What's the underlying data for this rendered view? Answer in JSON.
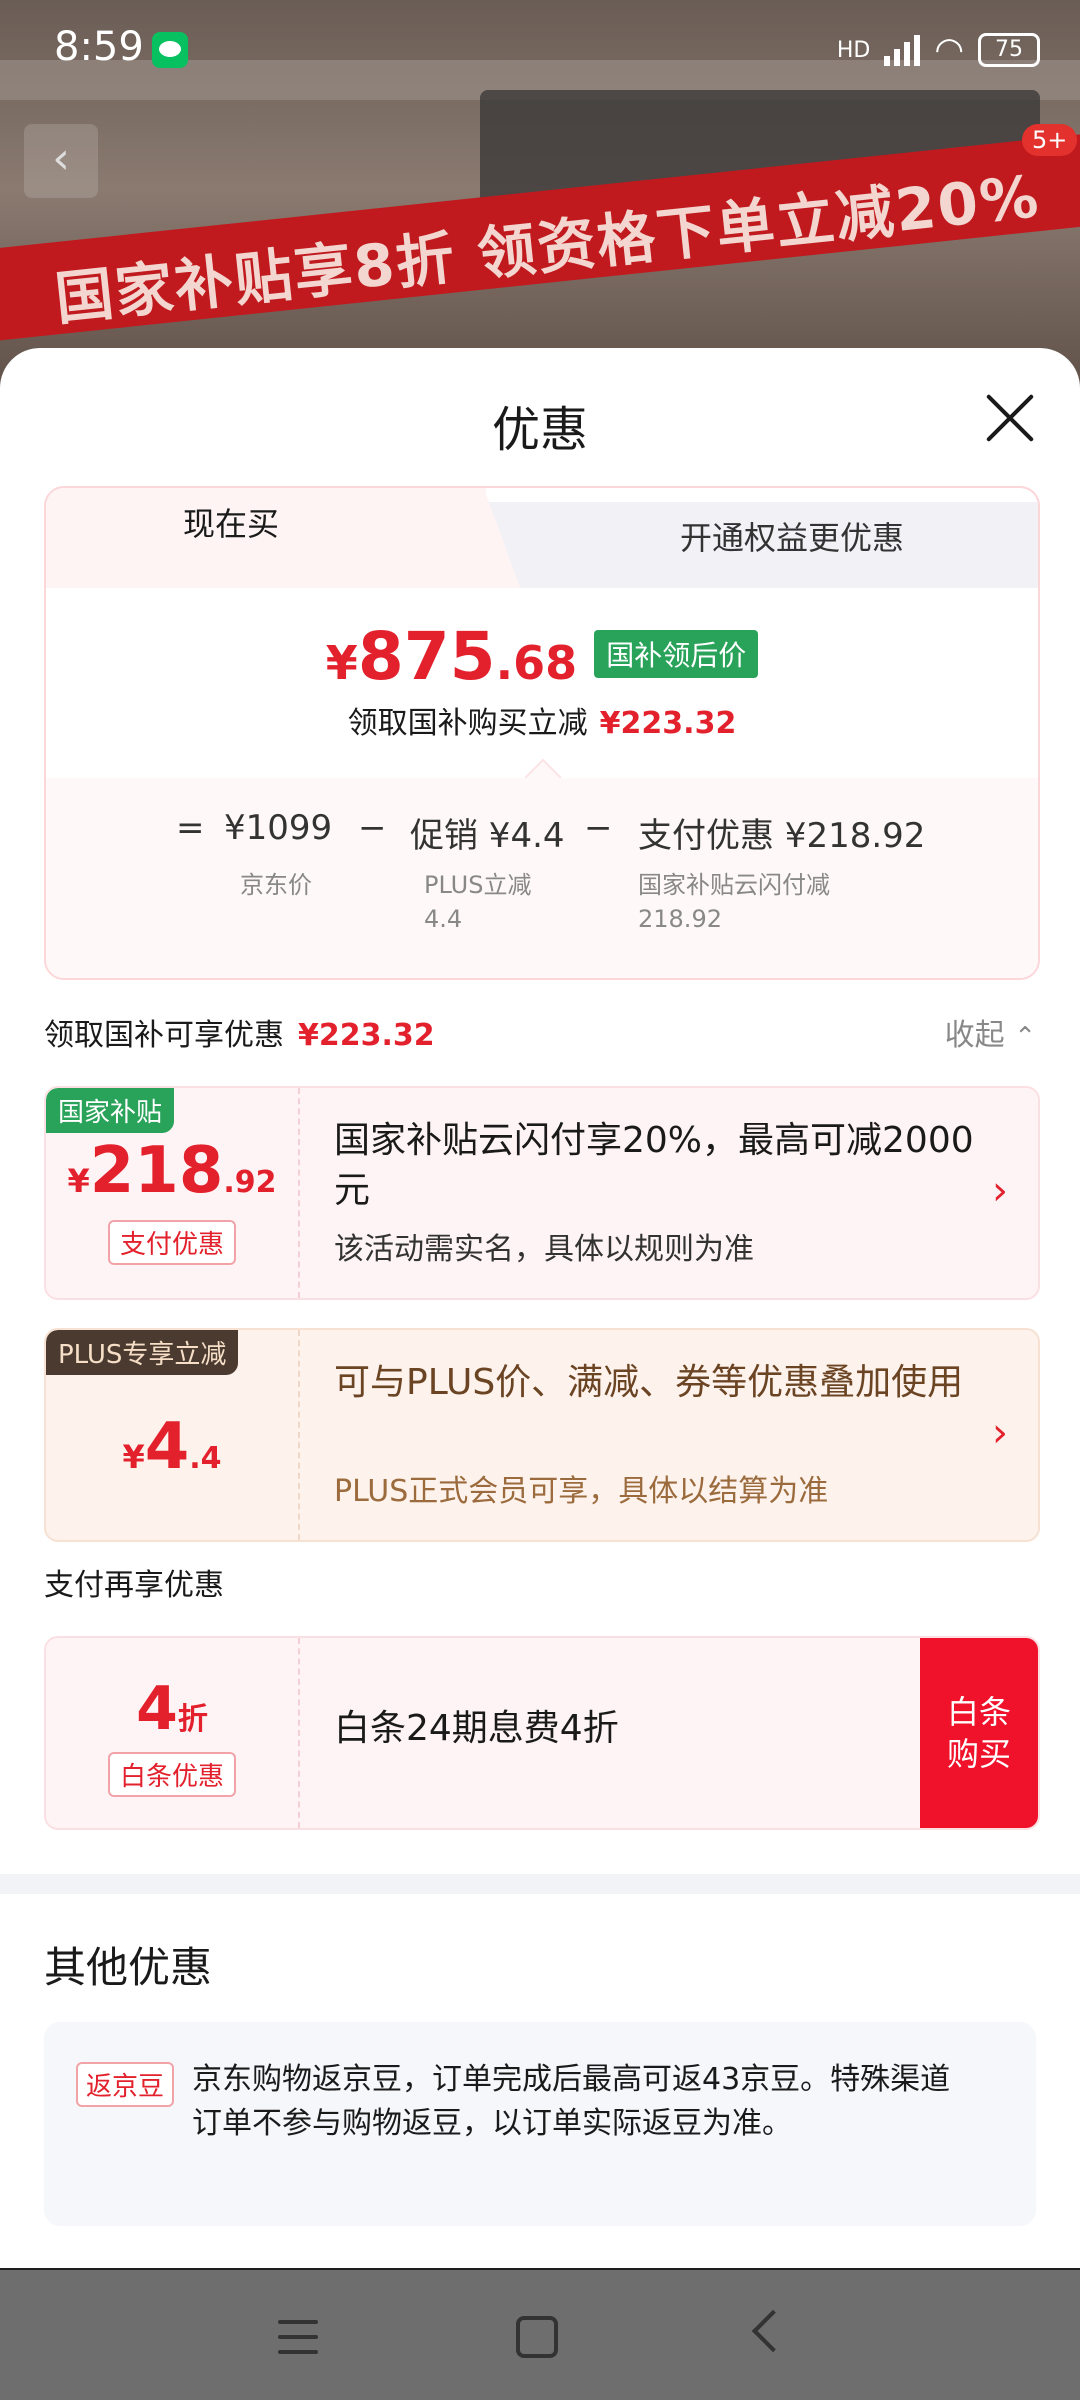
{
  "status": {
    "time": "8:59",
    "signal": "HD",
    "battery": "75"
  },
  "background": {
    "banner_text": "国家补贴享8折 领资格下单立减20%",
    "cart_badge": "5+"
  },
  "sheet": {
    "title": "优惠",
    "tabs": {
      "active": "现在买",
      "other": "开通权益更优惠"
    },
    "price": {
      "yen": "¥",
      "integer": "875",
      "decimal": ".68",
      "tag": "国补领后价",
      "sub_label": "领取国补购买立减",
      "sub_amount": "¥223.32"
    },
    "breakdown": {
      "eq": "=",
      "base": "¥1099",
      "base_label": "京东价",
      "minus1": "−",
      "promo": "促销 ¥4.4",
      "promo_label1": "PLUS立减",
      "promo_label2": "4.4",
      "minus2": "−",
      "pay": "支付优惠 ¥218.92",
      "pay_label1": "国家补贴云闪付减",
      "pay_label2": "218.92"
    },
    "section1": {
      "label": "领取国补可享优惠",
      "amount": "¥223.32",
      "collapse": "收起"
    },
    "promo1": {
      "tag": "国家补贴",
      "yen": "¥",
      "int": "218",
      "dec": ".92",
      "sublabel": "支付优惠",
      "desc": "国家补贴云闪付享20%，最高可减2000元",
      "desc2": "该活动需实名，具体以规则为准",
      "arrow": "›"
    },
    "promo2": {
      "tag": "PLUS专享立减",
      "yen": "¥",
      "int": "4",
      "dec": ".4",
      "desc": "可与PLUS价、满减、券等优惠叠加使用",
      "desc2": "PLUS正式会员可享，具体以结算为准",
      "arrow": "›"
    },
    "section2": {
      "label": "支付再享优惠"
    },
    "promo3": {
      "int": "4",
      "unit": "折",
      "sublabel": "白条优惠",
      "desc": "白条24期息费4折",
      "button": "白条购买"
    },
    "other": {
      "title": "其他优惠",
      "tag": "返京豆",
      "text": "京东购物返京豆，订单完成后最高可返43京豆。特殊渠道订单不参与购物返豆，以订单实际返豆为准。"
    }
  },
  "colors": {
    "accent": "#e3212d",
    "green": "#29a35a",
    "plus": "#4a3a30"
  }
}
